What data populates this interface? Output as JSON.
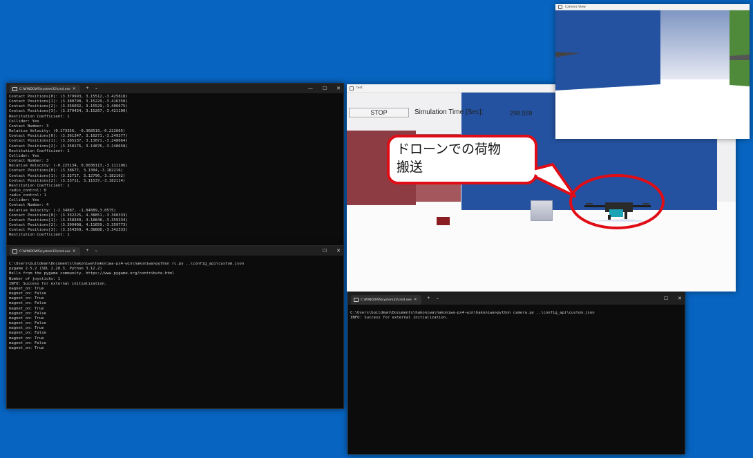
{
  "terminal1": {
    "tab_title": "C:\\WINDOWS\\system32\\cmd.exe",
    "tab_close": "×",
    "tab_new": "+",
    "tab_dropdown": "⌄",
    "minimize": "—",
    "maximize": "☐",
    "close": "✕",
    "output": "Contact Positions[0]: (3.379993, 3.15512,-3.425818)\nContact Positions[1]: (3.380790, 3.15229,-3.416350)\nContact Positions[2]: (3.356032, 3.15529,-3.406675)\nContact Positions[3]: (3.379434, 3.15267,-3.421100)\nRestitution Coefficient: 1\nCollider: Yes\nContact Number: 3\nRelative Velocity: (0.173356, -0.368519,-0.222665)\nContact Positions[0]: (3.361347, 3.10271,-3.249377)\nContact Positions[1]: (3.385137, 3.13071,-3.248664)\nContact Positions[2]: (3.358176, 3.14876,-3.248658)\nRestitution Coefficient: 1\nCollider: Yes\nContact Number: 3\nRelative Velocity: (-0.225134, 0.0030113,-3.111196)\nContact Positions[0]: (3.38677, 3.1304,-3.182216)\nContact Positions[1]: (3.32717, 3.12796,-3.182162)\nContact Positions[2]: (3.33711, 3.11537,-3.182114)\nRestitution Coefficient: 1\nradio_control: 0\nradio_control: 1\nCollider: Yes\nContact Number: 4\nRelative Velocity: (-2.34887, -1.84889,3.0575)\nContact Positions[0]: (3.332225, 4.38851,-3.360333)\nContact Positions[1]: (3.358340, 4.18848,-3.359334)\nContact Positions[2]: (3.399408, 4.11659,-3.359773)\nContact Positions[3]: (3.354369, 4.38888,-3.342333)\nRestitution Coefficient: 1"
  },
  "terminal2": {
    "tab_title": "C:\\WINDOWS\\system32\\cmd.exe",
    "tab_close": "×",
    "tab_new": "+",
    "tab_dropdown": "⌄",
    "maximize": "☐",
    "close": "✕",
    "output": "\nC:\\Users\\buildman\\Documents\\hakoniwa\\hakoniwa-px4-win\\hakoniwa>python rc.py ..\\config_api\\custom.json\npygame 2.5.2 (SDL 2.28.3, Python 3.12.2)\nHello from the pygame community. https://www.pygame.org/contribute.html\nNumber of joysticks: 1\nINFO: Success for external initialization.\nmagnet_on: True\nmagnet_on: False\nmagnet_on: True\nmagnet_on: False\nmagnet_on: True\nmagnet_on: False\nmagnet_on: True\nmagnet_on: False\nmagnet_on: True\nmagnet_on: False\nmagnet_on: True\nmagnet_on: False\nmagnet_on: True"
  },
  "terminal3": {
    "tab_title": "C:\\WINDOWS\\system32\\cmd.exe",
    "tab_close": "×",
    "tab_new": "+",
    "tab_dropdown": "⌄",
    "maximize": "☐",
    "close": "✕",
    "output": "\nC:\\Users\\buildman\\Documents\\hakoniwa\\hakoniwa-px4-win\\hakoniwa>python camera.py ..\\config_api\\custom.json\nINFO: Success for external initialization."
  },
  "unity": {
    "title": "test",
    "stop_label": "STOP",
    "sim_time_label": "Simulation Time [Sec]:",
    "sim_time_value": "298.569"
  },
  "camera": {
    "title": "Camera View"
  },
  "callout": {
    "line1": "ドローンでの荷物",
    "line2": "搬送",
    "color": "#e00d16"
  },
  "colors": {
    "desktop": "#0764c0",
    "terminal_bg": "#0c0c0c",
    "terminal_text": "#cccccc",
    "wall_blue": "#2452a0",
    "wall_red": "#8e3c44",
    "wall_green": "#4e8a39"
  }
}
